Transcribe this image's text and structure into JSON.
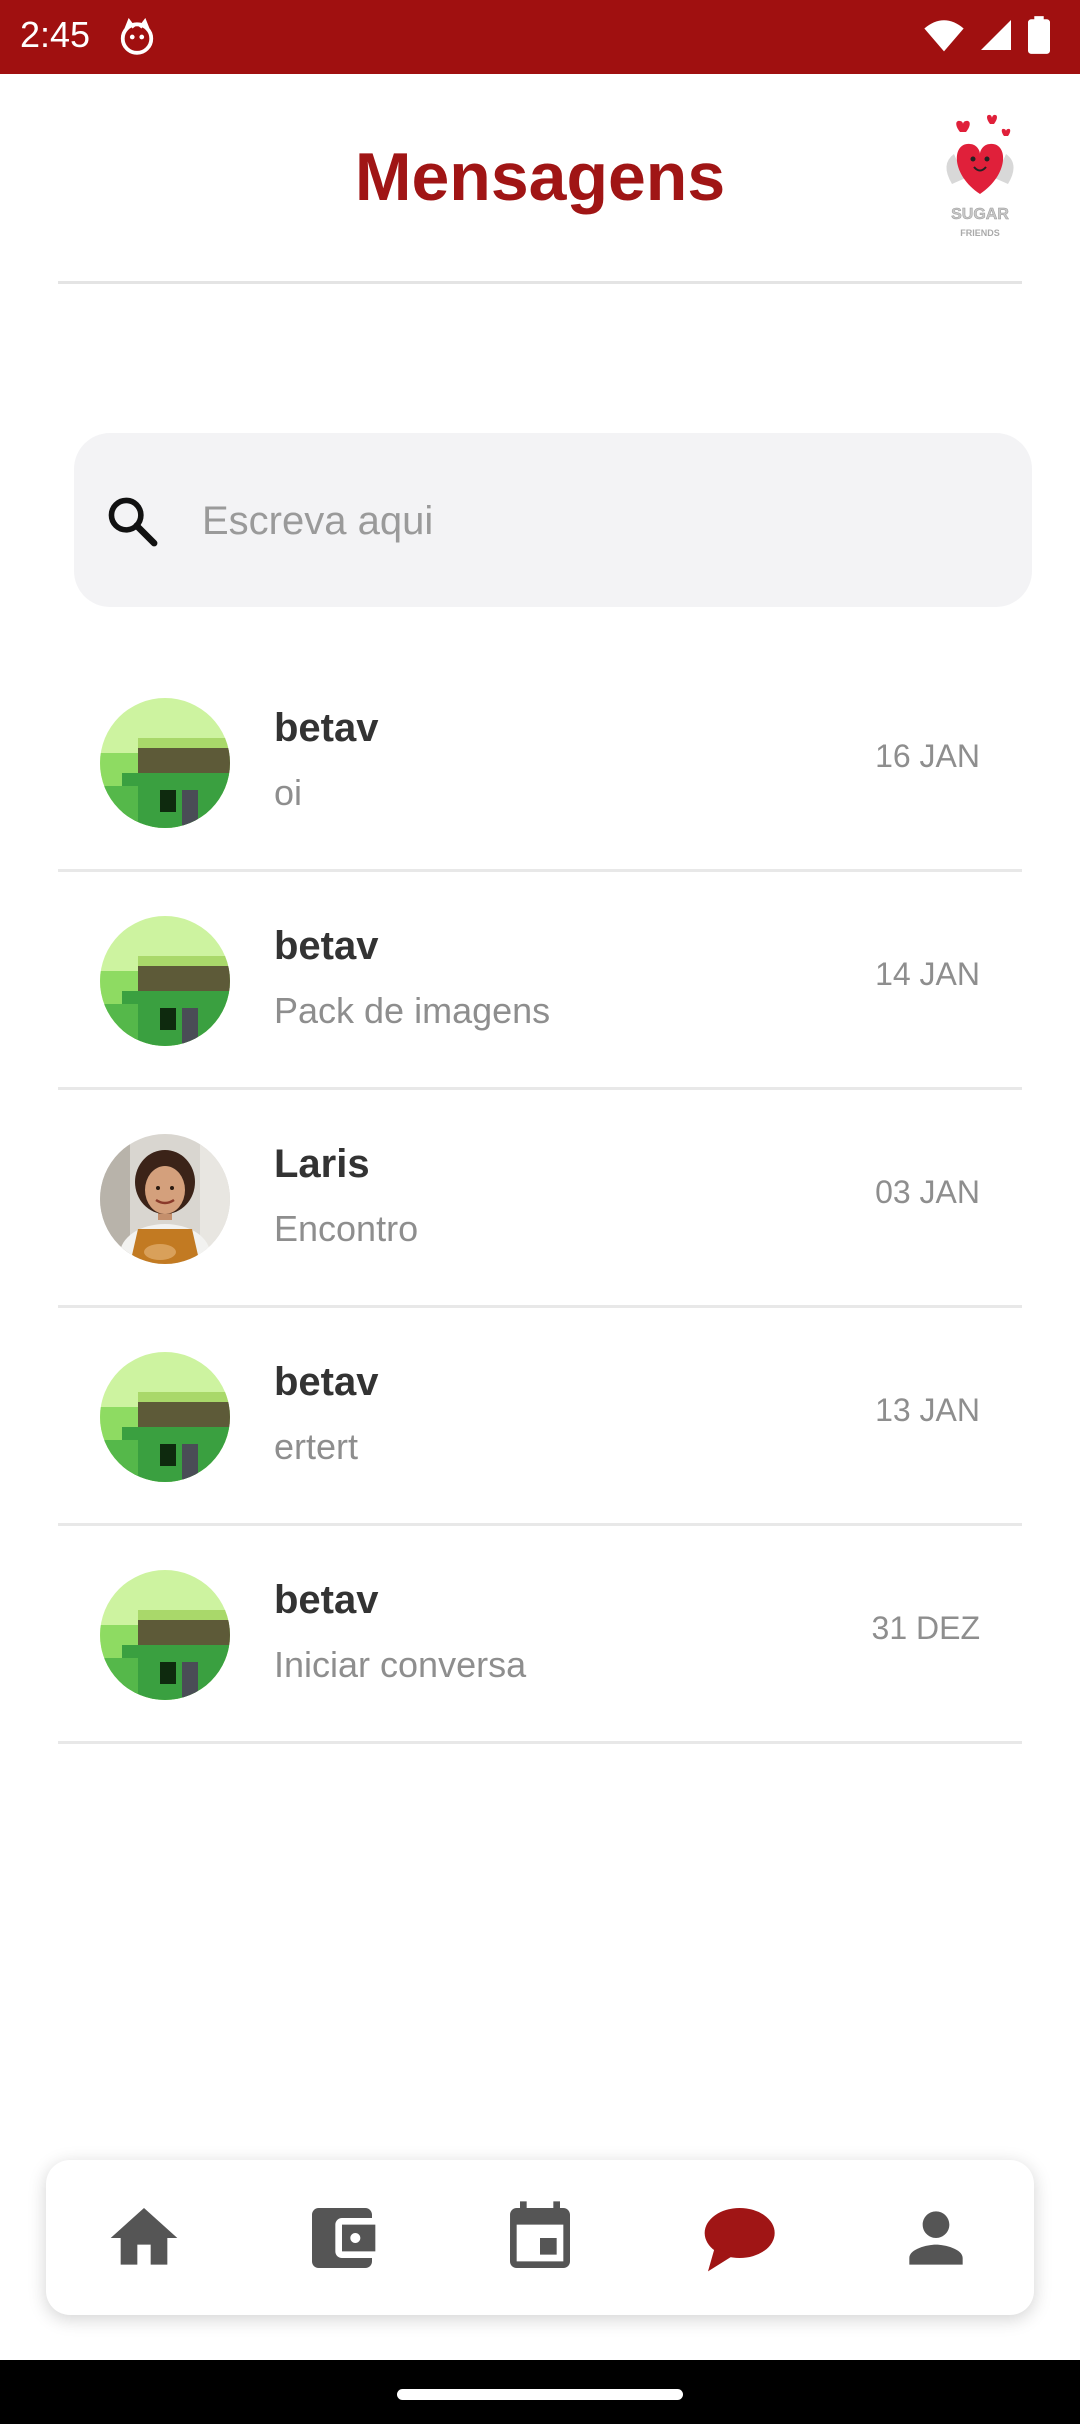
{
  "status_bar": {
    "time": "2:45"
  },
  "header": {
    "title": "Mensagens",
    "logo_text": "SUGAR FRIENDS"
  },
  "search": {
    "placeholder": "Escreva aqui",
    "value": ""
  },
  "conversations": [
    {
      "name": "betav",
      "last_message": "oi",
      "date": "16 JAN",
      "avatar": "pixel-avatar"
    },
    {
      "name": "betav",
      "last_message": "Pack de imagens",
      "date": "14 JAN",
      "avatar": "pixel-avatar"
    },
    {
      "name": "Laris",
      "last_message": "Encontro",
      "date": "03 JAN",
      "avatar": "photo-avatar"
    },
    {
      "name": "betav",
      "last_message": "ertert",
      "date": "13 JAN",
      "avatar": "pixel-avatar"
    },
    {
      "name": "betav",
      "last_message": "Iniciar conversa",
      "date": "31 DEZ",
      "avatar": "pixel-avatar"
    }
  ],
  "bottom_nav": {
    "items": [
      {
        "icon": "home-icon",
        "active": false
      },
      {
        "icon": "wallet-icon",
        "active": false
      },
      {
        "icon": "calendar-icon",
        "active": false
      },
      {
        "icon": "chat-icon",
        "active": true
      },
      {
        "icon": "person-icon",
        "active": false
      }
    ]
  },
  "colors": {
    "brand": "#a01515",
    "status_bar": "#a01010",
    "nav_inactive": "#555555",
    "text_muted": "#8e8e8e"
  }
}
